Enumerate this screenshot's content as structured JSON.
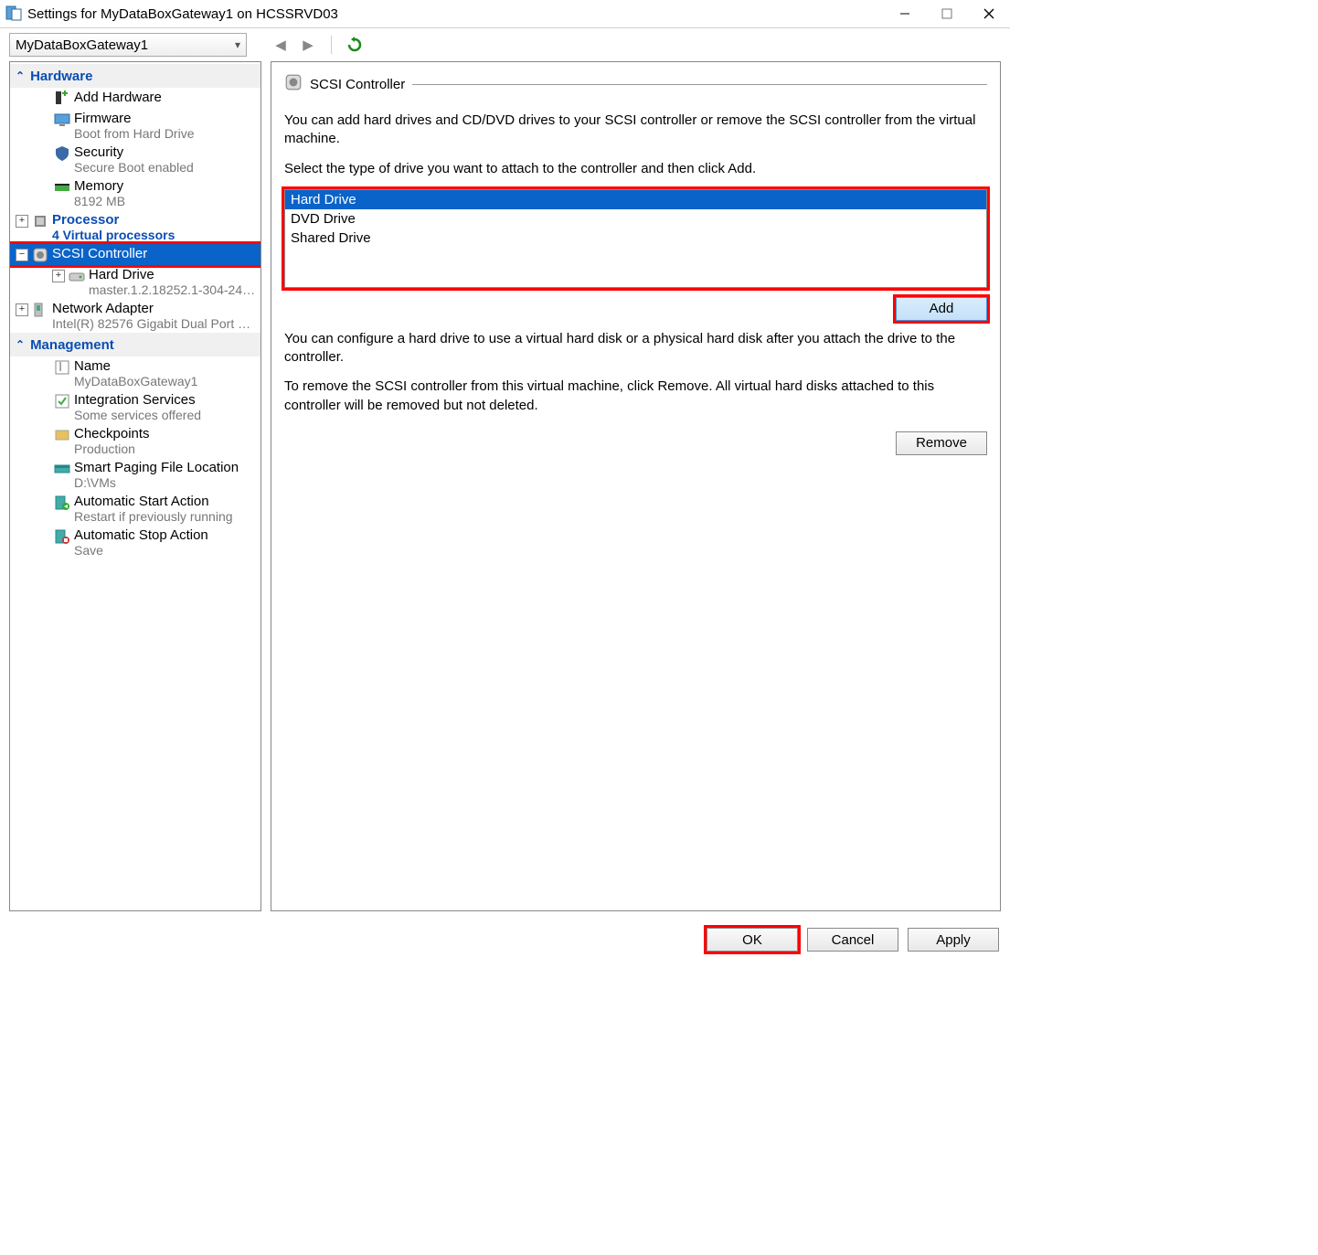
{
  "window": {
    "title": "Settings for MyDataBoxGateway1 on HCSSRVD03"
  },
  "toolbar": {
    "vm_name": "MyDataBoxGateway1"
  },
  "tree": {
    "hardware_header": "Hardware",
    "add_hardware": "Add Hardware",
    "firmware": "Firmware",
    "firmware_sub": "Boot from Hard Drive",
    "security": "Security",
    "security_sub": "Secure Boot enabled",
    "memory": "Memory",
    "memory_sub": "8192 MB",
    "processor": "Processor",
    "processor_sub": "4 Virtual processors",
    "scsi": "SCSI Controller",
    "hard_drive": "Hard Drive",
    "hard_drive_sub": "master.1.2.18252.1-304-2472...",
    "net_adapter": "Network Adapter",
    "net_adapter_sub": "Intel(R) 82576 Gigabit Dual Port N...",
    "management_header": "Management",
    "name": "Name",
    "name_sub": "MyDataBoxGateway1",
    "integration": "Integration Services",
    "integration_sub": "Some services offered",
    "checkpoints": "Checkpoints",
    "checkpoints_sub": "Production",
    "smart_paging": "Smart Paging File Location",
    "smart_paging_sub": "D:\\VMs",
    "auto_start": "Automatic Start Action",
    "auto_start_sub": "Restart if previously running",
    "auto_stop": "Automatic Stop Action",
    "auto_stop_sub": "Save"
  },
  "right": {
    "title": "SCSI Controller",
    "para1": "You can add hard drives and CD/DVD drives to your SCSI controller or remove the SCSI controller from the virtual machine.",
    "para2": "Select the type of drive you want to attach to the controller and then click Add.",
    "drive_options": {
      "hd": "Hard Drive",
      "dvd": "DVD Drive",
      "shared": "Shared Drive"
    },
    "add_btn": "Add",
    "para3": "You can configure a hard drive to use a virtual hard disk or a physical hard disk after you attach the drive to the controller.",
    "para4": "To remove the SCSI controller from this virtual machine, click Remove. All virtual hard disks attached to this controller will be removed but not deleted.",
    "remove_btn": "Remove"
  },
  "bottom": {
    "ok": "OK",
    "cancel": "Cancel",
    "apply": "Apply"
  }
}
